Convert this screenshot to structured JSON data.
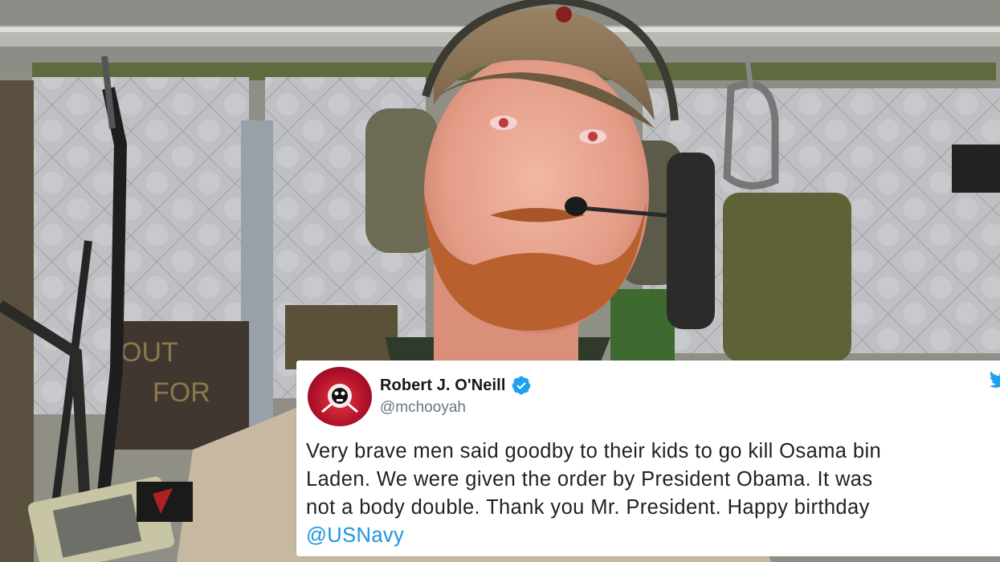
{
  "tweet": {
    "author_name": "Robert J. O'Neill",
    "handle": "@mchooyah",
    "text_lines": [
      "Very brave men said goodby to their kids to go kill Osama bin",
      "Laden. We were given the order by President Obama. It was",
      "not a body double. Thank you Mr. President. Happy birthday"
    ],
    "mention": "@USNavy",
    "accent_color": "#1da1f2"
  },
  "photo": {
    "cap_color": "#8a7355",
    "beard_color": "#b8612e",
    "quilt_color": "#c3c3c6"
  }
}
